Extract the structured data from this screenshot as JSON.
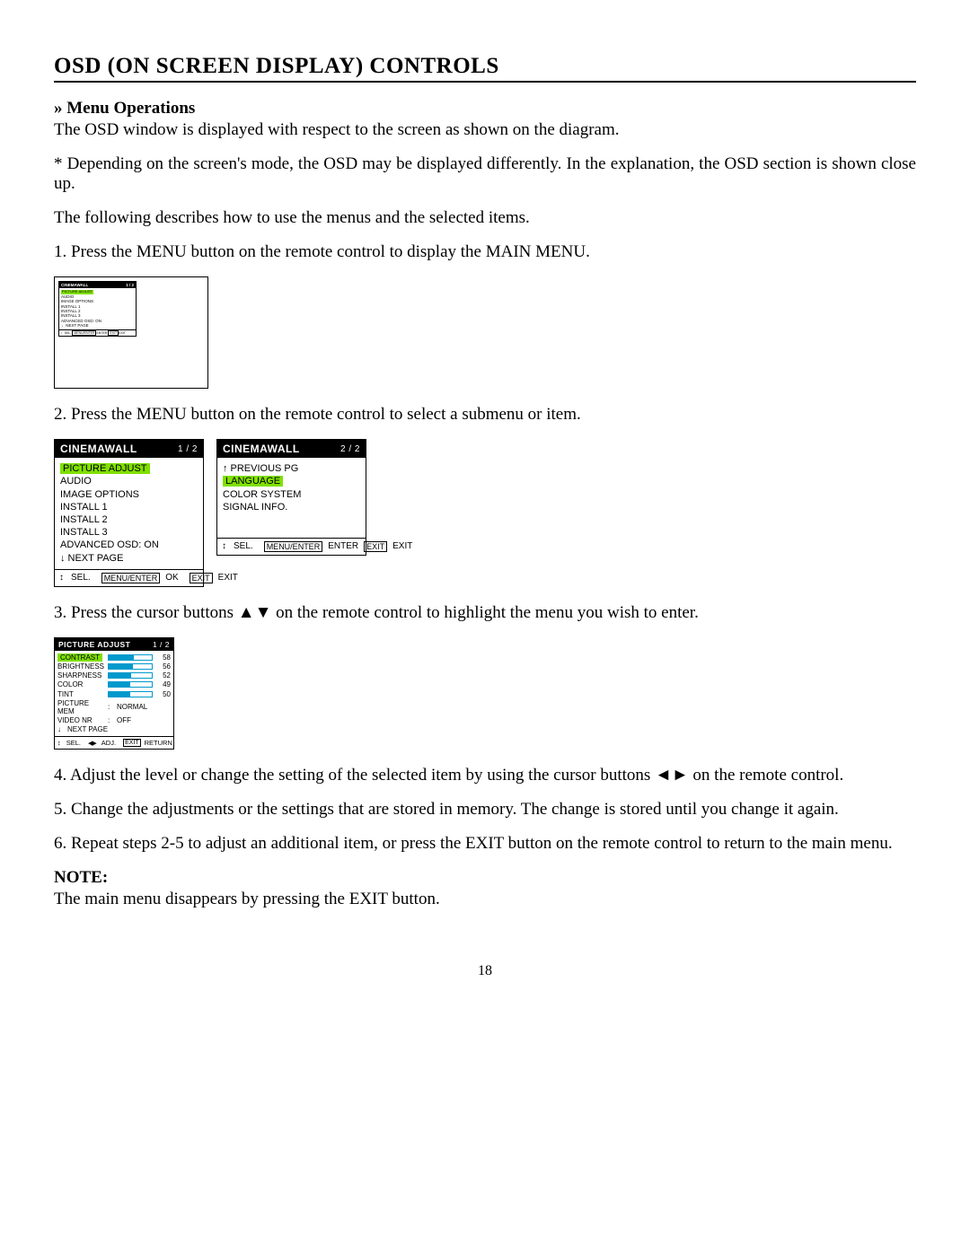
{
  "title": "OSD (ON SCREEN DISPLAY) CONTROLS",
  "subhead": "» Menu Operations",
  "p_intro": "The OSD window is displayed with respect to the screen as shown on the diagram.",
  "p_note1": "* Depending on the screen's mode, the OSD may be displayed differently. In the explanation, the OSD section is shown close up.",
  "p_follow": "The following describes how to use the menus and the selected items.",
  "step1": "1. Press the MENU button on the remote control to display the MAIN MENU.",
  "step2": "2. Press the MENU button on the remote control to select a submenu or item.",
  "step3": "3. Press the cursor buttons ▲▼ on the remote control to highlight the menu you wish to enter.",
  "step4": "4. Adjust the level or change the setting of the selected item by using the cursor buttons ◄► on the remote control.",
  "step5": "5. Change the adjustments or the settings that are stored in memory. The change is stored until you change it again.",
  "step6": "6. Repeat steps 2-5 to adjust an additional item, or press the EXIT button on the remote control to return to the main menu.",
  "note_head": "NOTE:",
  "note_body": "The main menu disappears by pressing the EXIT button.",
  "page_num": "18",
  "osd": {
    "brand": "CINEMAWALL",
    "page12": "1 / 2",
    "page22": "2 / 2",
    "menu1": {
      "selected": "PICTURE ADJUST",
      "items": [
        "AUDIO",
        "IMAGE OPTIONS",
        "INSTALL 1",
        "INSTALL 2",
        "INSTALL 3",
        "ADVANCED OSD: ON"
      ],
      "next": "NEXT PAGE"
    },
    "menu2b": {
      "prev": "PREVIOUS PG",
      "selected": "LANGUAGE",
      "items": [
        "COLOR SYSTEM",
        "SIGNAL INFO."
      ]
    },
    "footer_sel": "SEL.",
    "footer_menu_enter": "MENU/ENTER",
    "footer_ok": "OK",
    "footer_enter": "ENTER",
    "footer_exit_box": "EXIT",
    "footer_exit": "EXIT",
    "footer_adj": "ADJ.",
    "footer_return": "RETURN",
    "picture": {
      "title": "PICTURE ADJUST",
      "selected": "CONTRAST",
      "rows": [
        {
          "label": "CONTRAST",
          "value": 58,
          "pct": 58
        },
        {
          "label": "BRIGHTNESS",
          "value": 56,
          "pct": 56
        },
        {
          "label": "SHARPNESS",
          "value": 52,
          "pct": 52
        },
        {
          "label": "COLOR",
          "value": 49,
          "pct": 49
        },
        {
          "label": "TINT",
          "value": 50,
          "pct": 50
        }
      ],
      "text_rows": [
        {
          "label": "PICTURE MEM",
          "value": "NORMAL"
        },
        {
          "label": "VIDEO NR",
          "value": "OFF"
        }
      ],
      "next": "NEXT PAGE"
    }
  }
}
